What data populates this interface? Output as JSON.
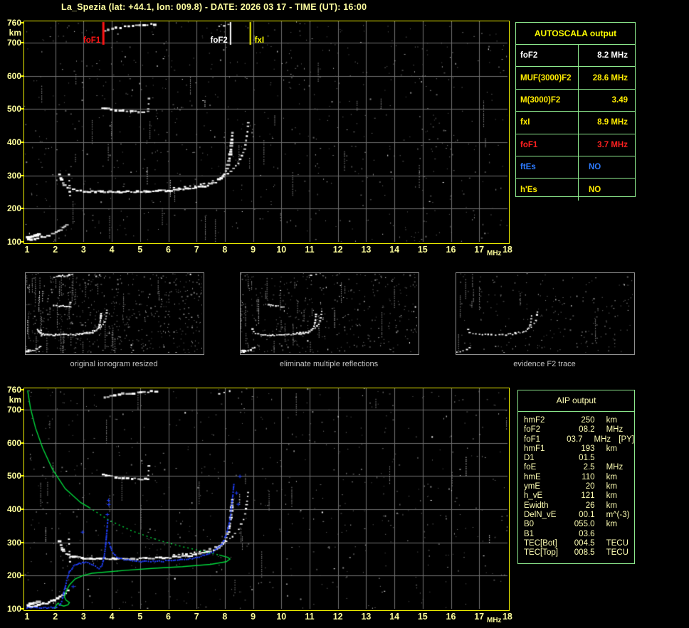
{
  "window": {
    "title": "La_Spezia (lat: +44.1, lon: 009.8) - DATE: 2026 03 17 - TIME (UT): 16:00"
  },
  "colors": {
    "accent_yellow": "#ffff9c",
    "border_yellow": "#f0f000",
    "table_green": "#8ce88c",
    "header_yellow": "#ffff00",
    "value_yellow": "#ffec00",
    "alert_red": "#ff2020",
    "info_blue": "#2e7bff",
    "pale_text": "#ffffb4",
    "profile_green": "#00d83c",
    "trace_blue": "#2040ff",
    "grid_gray": "#707070",
    "noise_gray": "#8a8a8a",
    "caption_gray": "#c4c4c4",
    "thumb_border": "#909090"
  },
  "axes": {
    "x_labels": [
      "1",
      "2",
      "3",
      "4",
      "5",
      "6",
      "7",
      "8",
      "9",
      "10",
      "11",
      "12",
      "13",
      "14",
      "15",
      "16",
      "17",
      "18"
    ],
    "x_unit": "MHz",
    "y_unit": "km",
    "y_ticks": [
      760,
      700,
      600,
      500,
      400,
      300,
      200,
      100
    ]
  },
  "top_plot": {
    "markers": [
      {
        "label": "foF1",
        "f": 3.7,
        "color": "#ff1414",
        "side": "left",
        "line_w": 3
      },
      {
        "label": "foF2",
        "f": 8.2,
        "color": "#ffffff",
        "side": "left",
        "line_w": 2
      },
      {
        "label": "fxI",
        "f": 8.9,
        "color": "#ffff00",
        "side": "right",
        "line_w": 2
      }
    ]
  },
  "autoscala": {
    "title": "AUTOSCALA output",
    "rows": [
      {
        "param": "foF2",
        "value": "8.2 MHz",
        "color": "#ffffff",
        "align": "right"
      },
      {
        "param": "MUF(3000)F2",
        "value": "28.6 MHz",
        "color": "#ffec00",
        "align": "right"
      },
      {
        "param": "M(3000)F2",
        "value": "3.49",
        "color": "#ffec00",
        "align": "right"
      },
      {
        "param": "fxI",
        "value": "8.9 MHz",
        "color": "#ffec00",
        "align": "right"
      },
      {
        "param": "foF1",
        "value": "3.7 MHz",
        "color": "#ff2020",
        "align": "right"
      },
      {
        "param": "ftEs",
        "value": "NO",
        "color": "#2e7bff",
        "align": "left"
      },
      {
        "param": "h'Es",
        "value": "NO",
        "color": "#ffec00",
        "align": "left"
      }
    ]
  },
  "thumbnails": [
    {
      "caption": "original ionogram resized"
    },
    {
      "caption": "eliminate multiple reflections"
    },
    {
      "caption": "evidence F2 trace"
    }
  ],
  "aip": {
    "title": "AIP output",
    "rows": [
      {
        "name": "hmF2",
        "value": "250",
        "unit": "km",
        "extra": ""
      },
      {
        "name": "foF2",
        "value": "08.2",
        "unit": "MHz",
        "extra": ""
      },
      {
        "name": "foF1",
        "value": "03.7",
        "unit": "MHz",
        "extra": "[PY]"
      },
      {
        "name": "hmF1",
        "value": "193",
        "unit": "km",
        "extra": ""
      },
      {
        "name": "D1",
        "value": "01.5",
        "unit": "",
        "extra": ""
      },
      {
        "name": "foE",
        "value": "2.5",
        "unit": "MHz",
        "extra": ""
      },
      {
        "name": "hmE",
        "value": "110",
        "unit": "km",
        "extra": ""
      },
      {
        "name": "ymE",
        "value": "20",
        "unit": "km",
        "extra": ""
      },
      {
        "name": "h_vE",
        "value": "121",
        "unit": "km",
        "extra": ""
      },
      {
        "name": "Ewidth",
        "value": "26",
        "unit": "km",
        "extra": ""
      },
      {
        "name": "DelN_vE",
        "value": "00.1",
        "unit": "m^(-3)",
        "extra": ""
      },
      {
        "name": "B0",
        "value": "055.0",
        "unit": "km",
        "extra": ""
      },
      {
        "name": "B1",
        "value": "03.6",
        "unit": "",
        "extra": ""
      },
      {
        "name": "TEC[Bot]",
        "value": "004.5",
        "unit": "TECU",
        "extra": ""
      },
      {
        "name": "TEC[Top]",
        "value": "008.5",
        "unit": "TECU",
        "extra": ""
      }
    ]
  },
  "chart_data": [
    {
      "type": "scatter",
      "title": "ionogram with autoscaled characteristic frequencies",
      "xlabel": "MHz",
      "ylabel": "km",
      "xlim": [
        1,
        18
      ],
      "ylim": [
        100,
        760
      ],
      "grid": true,
      "annotations": [
        "foF1 = 3.7 MHz",
        "foF2 = 8.2 MHz",
        "fxI = 8.9 MHz"
      ]
    },
    {
      "type": "scatter",
      "title": "ionogram with restored trace and electron density profile",
      "xlabel": "MHz",
      "ylabel": "km",
      "xlim": [
        1,
        18
      ],
      "ylim": [
        100,
        760
      ],
      "grid": true,
      "series": [
        "ionogram echoes (white)",
        "restored trace (blue)",
        "Ne profile (green, dotted = modeled)"
      ]
    }
  ],
  "traces": {
    "ionogram": [
      {
        "mode": "blocky",
        "step": 4,
        "size": 3,
        "pts": [
          [
            2.15,
            302
          ],
          [
            2.3,
            272
          ],
          [
            2.55,
            258
          ],
          [
            3.0,
            252
          ],
          [
            4.0,
            250
          ],
          [
            5.0,
            251
          ],
          [
            6.0,
            254
          ],
          [
            6.8,
            260
          ],
          [
            7.3,
            268
          ],
          [
            7.7,
            280
          ],
          [
            7.95,
            298
          ],
          [
            8.1,
            325
          ],
          [
            8.2,
            365
          ],
          [
            8.25,
            410
          ],
          [
            8.27,
            432
          ]
        ]
      },
      {
        "mode": "blocky",
        "step": 6,
        "size": 2,
        "pts": [
          [
            6.2,
            262
          ],
          [
            6.9,
            268
          ],
          [
            7.4,
            277
          ],
          [
            7.8,
            290
          ],
          [
            8.2,
            312
          ],
          [
            8.5,
            340
          ],
          [
            8.7,
            378
          ],
          [
            8.8,
            430
          ],
          [
            8.83,
            462
          ]
        ]
      },
      {
        "mode": "blocky",
        "step": 5,
        "size": 3,
        "pts": [
          [
            3.75,
            737
          ],
          [
            4.3,
            746
          ],
          [
            5.0,
            752
          ],
          [
            5.6,
            756
          ]
        ]
      },
      {
        "mode": "blocky",
        "step": 7,
        "size": 2,
        "pts": [
          [
            7.8,
            748
          ],
          [
            8.1,
            754
          ],
          [
            8.3,
            757
          ]
        ]
      },
      {
        "mode": "blocky",
        "step": 5,
        "size": 3,
        "pts": [
          [
            3.7,
            503
          ],
          [
            4.2,
            496
          ],
          [
            4.8,
            492
          ],
          [
            5.2,
            490
          ]
        ]
      },
      {
        "mode": "blocky",
        "step": 6,
        "size": 2,
        "pts": [
          [
            5.28,
            492
          ],
          [
            5.3,
            515
          ],
          [
            5.32,
            538
          ]
        ]
      },
      {
        "mode": "blocky",
        "step": 4,
        "size": 3,
        "pts": [
          [
            1.05,
            106
          ],
          [
            1.35,
            110
          ],
          [
            1.7,
            117
          ],
          [
            2.0,
            127
          ],
          [
            2.25,
            140
          ],
          [
            2.45,
            155
          ]
        ]
      },
      {
        "mode": "blocky",
        "step": 7,
        "size": 2,
        "pts": [
          [
            2.52,
            240
          ],
          [
            2.5,
            275
          ],
          [
            2.48,
            310
          ]
        ]
      },
      {
        "mode": "blocky",
        "step": 3,
        "size": 4,
        "pts": [
          [
            1.05,
            112
          ],
          [
            1.25,
            117
          ],
          [
            1.45,
            122
          ]
        ]
      }
    ],
    "profile": [
      {
        "mode": "line",
        "dash": false,
        "pts": [
          [
            1.02,
            758
          ],
          [
            1.12,
            705
          ],
          [
            1.3,
            645
          ],
          [
            1.55,
            585
          ],
          [
            1.9,
            520
          ],
          [
            2.35,
            462
          ],
          [
            2.9,
            420
          ],
          [
            3.2,
            405
          ]
        ]
      },
      {
        "mode": "line",
        "dash": true,
        "pts": [
          [
            3.2,
            405
          ],
          [
            3.9,
            367
          ],
          [
            4.7,
            335
          ],
          [
            5.6,
            308
          ],
          [
            6.5,
            287
          ],
          [
            7.3,
            272
          ],
          [
            7.8,
            262
          ]
        ]
      },
      {
        "mode": "line",
        "dash": false,
        "pts": [
          [
            7.8,
            262
          ],
          [
            8.1,
            255
          ],
          [
            8.18,
            250
          ],
          [
            8.05,
            242
          ],
          [
            7.5,
            234
          ],
          [
            6.5,
            227
          ],
          [
            5.5,
            222
          ],
          [
            4.5,
            216
          ],
          [
            3.8,
            211
          ],
          [
            3.3,
            207
          ],
          [
            3.0,
            201
          ],
          [
            2.7,
            190
          ],
          [
            2.5,
            172
          ],
          [
            2.38,
            152
          ],
          [
            2.32,
            136
          ],
          [
            2.38,
            126
          ],
          [
            2.5,
            119
          ],
          [
            2.45,
            112
          ],
          [
            2.3,
            108
          ],
          [
            2.15,
            112
          ],
          [
            2.1,
            118
          ]
        ]
      },
      {
        "mode": "line",
        "dash": false,
        "pts": [
          [
            2.1,
            118
          ],
          [
            2.0,
            106
          ],
          [
            1.93,
            94
          ]
        ]
      }
    ],
    "restored": [
      {
        "mode": "dots",
        "pts": [
          [
            1.0,
            102
          ],
          [
            1.4,
            103
          ],
          [
            1.8,
            103
          ],
          [
            2.1,
            105
          ]
        ]
      },
      {
        "mode": "dots",
        "pts": [
          [
            2.15,
            110
          ],
          [
            2.25,
            128
          ],
          [
            2.32,
            155
          ],
          [
            2.4,
            185
          ],
          [
            2.5,
            212
          ],
          [
            2.65,
            228
          ],
          [
            2.85,
            237
          ]
        ]
      },
      {
        "mode": "dots",
        "pts": [
          [
            2.85,
            237
          ],
          [
            3.1,
            241
          ],
          [
            3.35,
            231
          ],
          [
            3.55,
            222
          ],
          [
            3.65,
            230
          ],
          [
            3.72,
            252
          ],
          [
            3.78,
            290
          ],
          [
            3.82,
            330
          ],
          [
            3.86,
            370
          ]
        ]
      },
      {
        "mode": "dots",
        "pts": [
          [
            3.9,
            300
          ],
          [
            4.0,
            275
          ],
          [
            4.15,
            258
          ],
          [
            4.4,
            248
          ],
          [
            4.8,
            244
          ],
          [
            5.3,
            242
          ],
          [
            5.8,
            243
          ],
          [
            6.3,
            246
          ],
          [
            6.8,
            251
          ],
          [
            7.2,
            259
          ],
          [
            7.6,
            272
          ],
          [
            7.9,
            295
          ],
          [
            8.05,
            322
          ],
          [
            8.15,
            355
          ],
          [
            8.22,
            395
          ],
          [
            8.28,
            440
          ],
          [
            8.32,
            478
          ]
        ]
      },
      {
        "mode": "plus",
        "pts": [
          [
            3.83,
            385
          ],
          [
            3.88,
            415
          ],
          [
            3.87,
            428
          ],
          [
            2.95,
            332
          ],
          [
            8.4,
            450
          ],
          [
            8.46,
            416
          ],
          [
            8.52,
            500
          ],
          [
            2.62,
            168
          ]
        ]
      }
    ]
  },
  "panels": {
    "top": {
      "canvas": "cv-top",
      "seed": 101,
      "pad": 4,
      "grid": true,
      "markers": true,
      "mul": 1,
      "sparse": 1,
      "noise": {
        "count": 780,
        "streaks": 30
      }
    },
    "bottom": {
      "canvas": "cv-bottom",
      "seed": 202,
      "pad": 4,
      "grid": true,
      "markers": false,
      "mul": 1,
      "sparse": 1,
      "noise": {
        "count": 640,
        "streaks": 26
      },
      "overlays": true
    },
    "thumb1": {
      "canvas": "cv-t1",
      "seed": 11,
      "pad": 0,
      "grid": false,
      "markers": false,
      "mul": 0.62,
      "sparse": 1,
      "noise": {
        "count": 560,
        "streaks": 42
      },
      "draw_idx": "all"
    },
    "thumb2": {
      "canvas": "cv-t2",
      "seed": 22,
      "pad": 0,
      "grid": false,
      "markers": false,
      "mul": 0.62,
      "sparse": 1.2,
      "noise": {
        "count": 380,
        "streaks": 26
      },
      "draw_idx": [
        0,
        1,
        3,
        4,
        6,
        8
      ]
    },
    "thumb3": {
      "canvas": "cv-t3",
      "seed": 33,
      "pad": 0,
      "grid": false,
      "markers": false,
      "mul": 0.5,
      "sparse": 2.2,
      "noise": {
        "count": 210,
        "streaks": 9
      },
      "draw_idx": [
        0,
        1,
        6
      ]
    }
  }
}
